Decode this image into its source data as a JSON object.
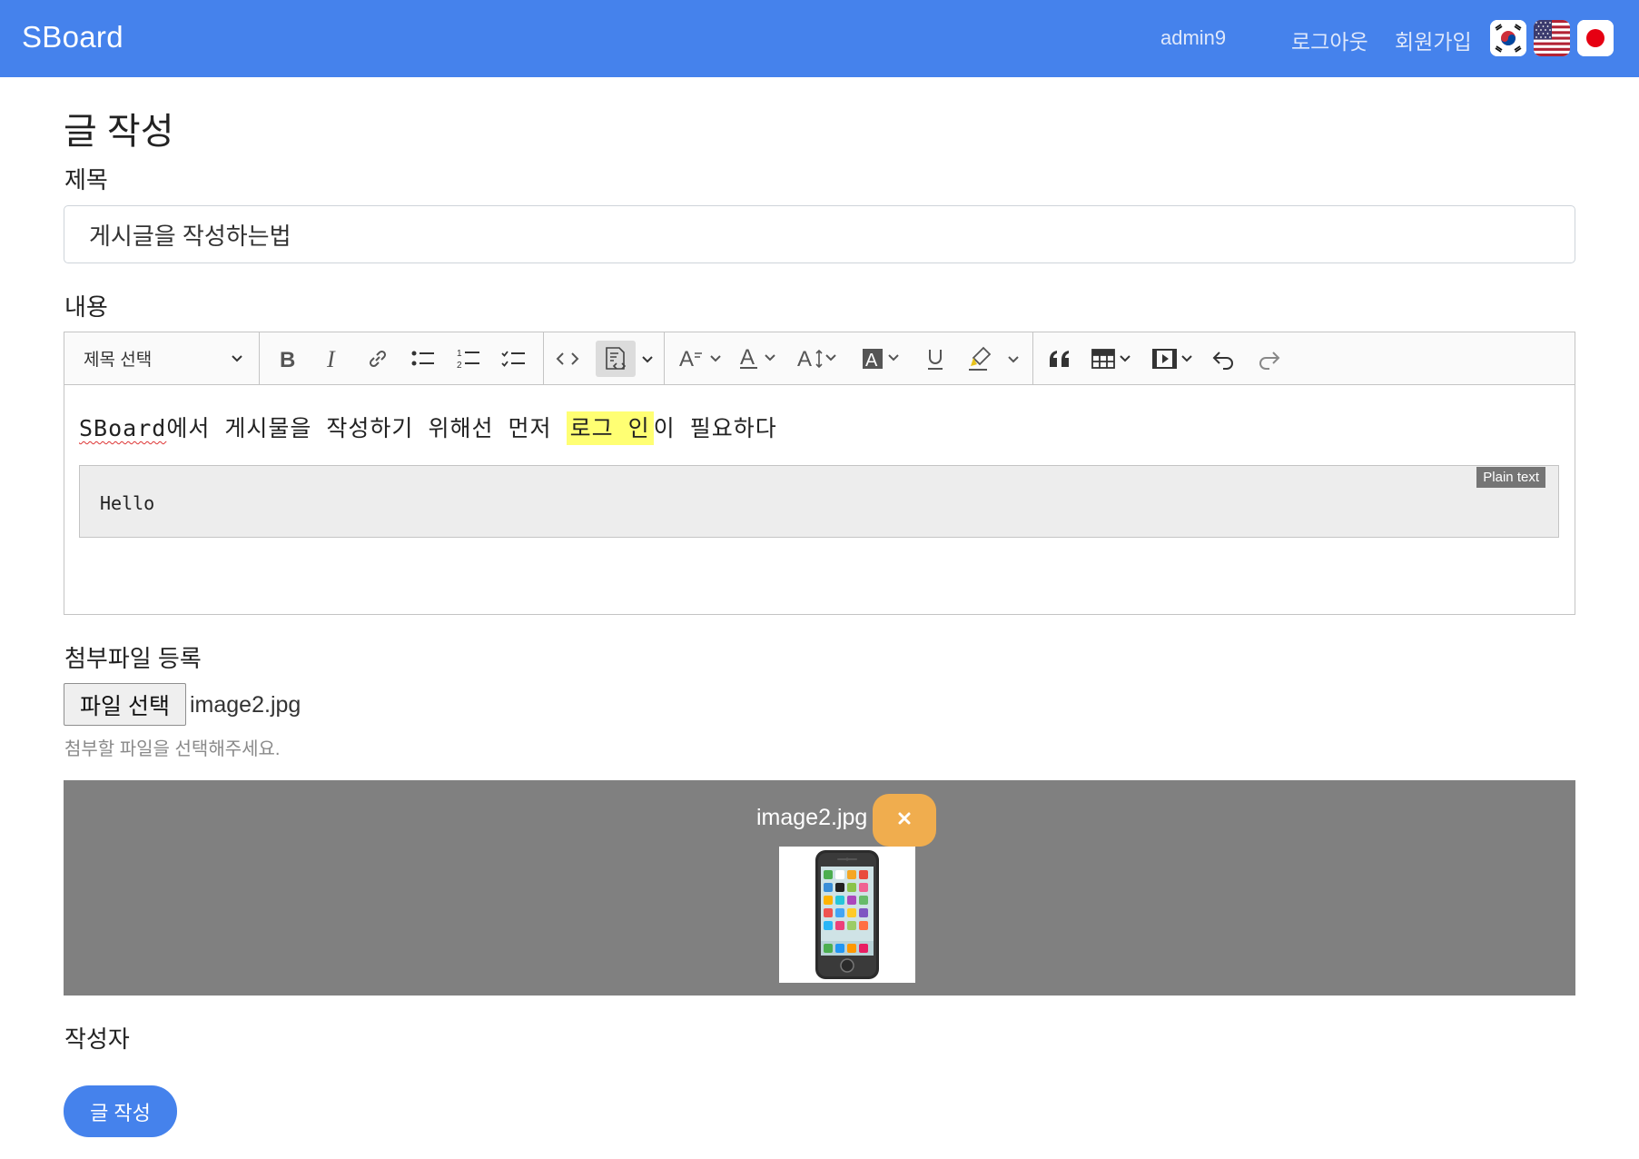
{
  "navbar": {
    "brand": "SBoard",
    "username": "admin9",
    "logout": "로그아웃",
    "signup": "회원가입",
    "flags": [
      "korea-flag-icon",
      "usa-flag-icon",
      "japan-flag-icon"
    ],
    "bg_color": "#4582ec"
  },
  "page": {
    "title": "글 작성"
  },
  "form": {
    "title_label": "제목",
    "title_value": "게시글을 작성하는법",
    "content_label": "내용",
    "attach_label": "첨부파일 등록",
    "author_label": "작성자",
    "submit_label": "글 작성"
  },
  "editor": {
    "heading_select": "제목 선택",
    "toolbar_icons": [
      "bold-icon",
      "italic-icon",
      "link-icon",
      "bulleted-list-icon",
      "numbered-list-icon",
      "todo-list-icon",
      "code-icon",
      "insert-code-block-icon",
      "font-size-icon",
      "font-color-icon",
      "line-height-icon",
      "font-background-icon",
      "underline-icon",
      "highlight-icon",
      "blockquote-icon",
      "table-icon",
      "media-icon",
      "undo-icon",
      "redo-icon"
    ],
    "paragraph": {
      "part1": "SBoard",
      "part2": "에서 게시물을 작성하기 위해선 먼저 ",
      "highlight": "로그 인",
      "part3": "이 필요하다"
    },
    "code_block": {
      "language": "Plain text",
      "code": "Hello"
    },
    "highlight_color": "#ffff73"
  },
  "file": {
    "button": "파일 선택",
    "name": "image2.jpg",
    "hint": "첨부할 파일을 선택해주세요."
  },
  "preview": {
    "file_name": "image2.jpg",
    "remove_icon": "close-icon",
    "thumb_icon": "phone-image"
  },
  "colors": {
    "primary": "#4582ec",
    "warning": "#f0ad4e",
    "preview_bg": "#808080"
  }
}
